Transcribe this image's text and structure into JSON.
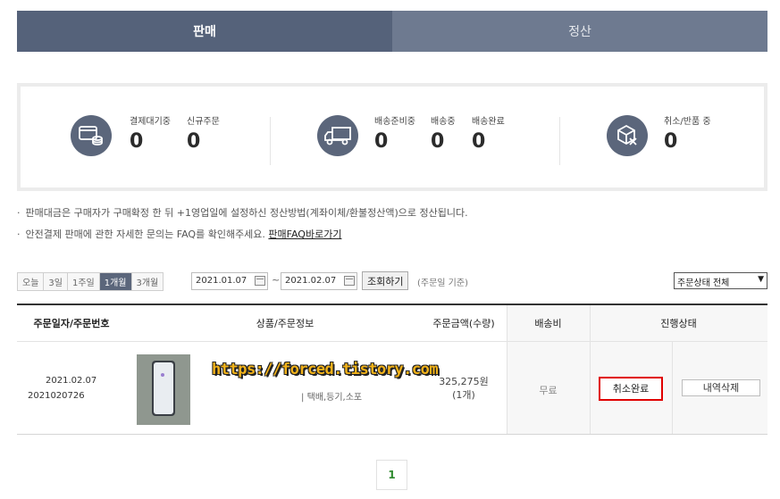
{
  "tabs": [
    {
      "label": "판매",
      "active": true
    },
    {
      "label": "정산",
      "active": false
    }
  ],
  "summary": {
    "groups": [
      {
        "icon": "card-payment-icon",
        "stats": [
          {
            "label": "결제대기중",
            "value": "0"
          },
          {
            "label": "신규주문",
            "value": "0"
          }
        ]
      },
      {
        "icon": "delivery-truck-icon",
        "stats": [
          {
            "label": "배송준비중",
            "value": "0"
          },
          {
            "label": "배송중",
            "value": "0"
          },
          {
            "label": "배송완료",
            "value": "0"
          }
        ]
      },
      {
        "icon": "cancel-box-icon",
        "stats": [
          {
            "label": "취소/반품 중",
            "value": "0"
          }
        ]
      }
    ]
  },
  "notes": {
    "line1": "판매대금은 구매자가 구매확정 한 뒤 +1영업일에 설정하신 정산방법(계좌이체/환불정산액)으로 정산됩니다.",
    "line2": "안전결제 판매에 관한 자세한 문의는 FAQ를 확인해주세요.",
    "faq_link": "판매FAQ바로가기"
  },
  "filters": {
    "periods": [
      "오늘",
      "3일",
      "1주일",
      "1개월",
      "3개월"
    ],
    "selected_period": "1개월",
    "date_from": "2021.01.07",
    "date_to": "2021.02.07",
    "tilde": "~",
    "search_button": "조회하기",
    "basis": "(주문일 기준)",
    "status_select": "주문상태 전체"
  },
  "table": {
    "headers": {
      "order": "주문일자/주문번호",
      "product": "상품/주문정보",
      "amount": "주문금액(수량)",
      "shipping": "배송비",
      "status": "진행상태"
    },
    "rows": [
      {
        "date": "2021.02.07",
        "order_no": "2021020726",
        "watermark": "https://forced.tistory.com",
        "delivery": "택배,등기,소포",
        "amount": "325,275원",
        "quantity": "(1개)",
        "shipping_fee": "무료",
        "status": "취소완료",
        "delete_button": "내역삭제"
      }
    ]
  },
  "pagination": {
    "current": "1"
  },
  "colors": {
    "tab_active": "#55627a",
    "status_highlight": "#e00000",
    "page_current": "#2f8a2f"
  }
}
